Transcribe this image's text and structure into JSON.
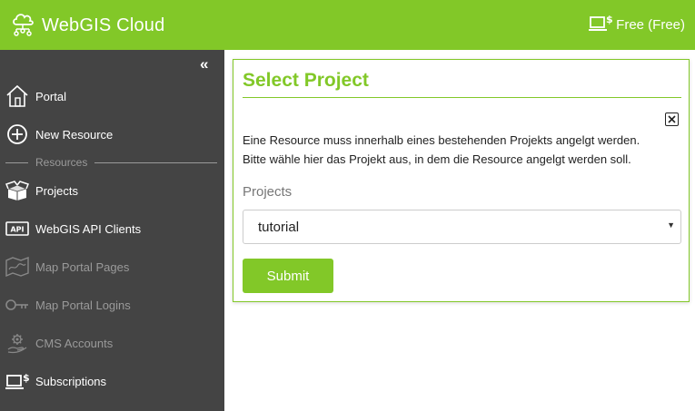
{
  "header": {
    "brand_title": "WebGIS Cloud",
    "plan_label": "Free (Free)"
  },
  "sidebar": {
    "collapse_label": "«",
    "section_label": "Resources",
    "items": [
      {
        "label": "Portal",
        "icon": "home-icon",
        "enabled": true
      },
      {
        "label": "New Resource",
        "icon": "plus-circle-icon",
        "enabled": true
      },
      {
        "label": "Projects",
        "icon": "box-icon",
        "enabled": true
      },
      {
        "label": "WebGIS API Clients",
        "icon": "api-icon",
        "enabled": true
      },
      {
        "label": "Map Portal Pages",
        "icon": "map-icon",
        "enabled": false
      },
      {
        "label": "Map Portal Logins",
        "icon": "key-icon",
        "enabled": false
      },
      {
        "label": "CMS Accounts",
        "icon": "gear-hand-icon",
        "enabled": false
      },
      {
        "label": "Subscriptions",
        "icon": "laptop-dollar-icon",
        "enabled": true
      }
    ]
  },
  "dialog": {
    "title": "Select Project",
    "message_line1": "Eine Resource muss innerhalb eines bestehenden Projekts angelgt werden.",
    "message_line2": "Bitte wähle hier das Projekt aus, in dem die Resource angelgt werden soll.",
    "field_label": "Projects",
    "selected_project": "tutorial",
    "submit_label": "Submit"
  },
  "colors": {
    "accent": "#82c828",
    "sidebar_bg": "#444444",
    "disabled_text": "#9a9a9a"
  }
}
